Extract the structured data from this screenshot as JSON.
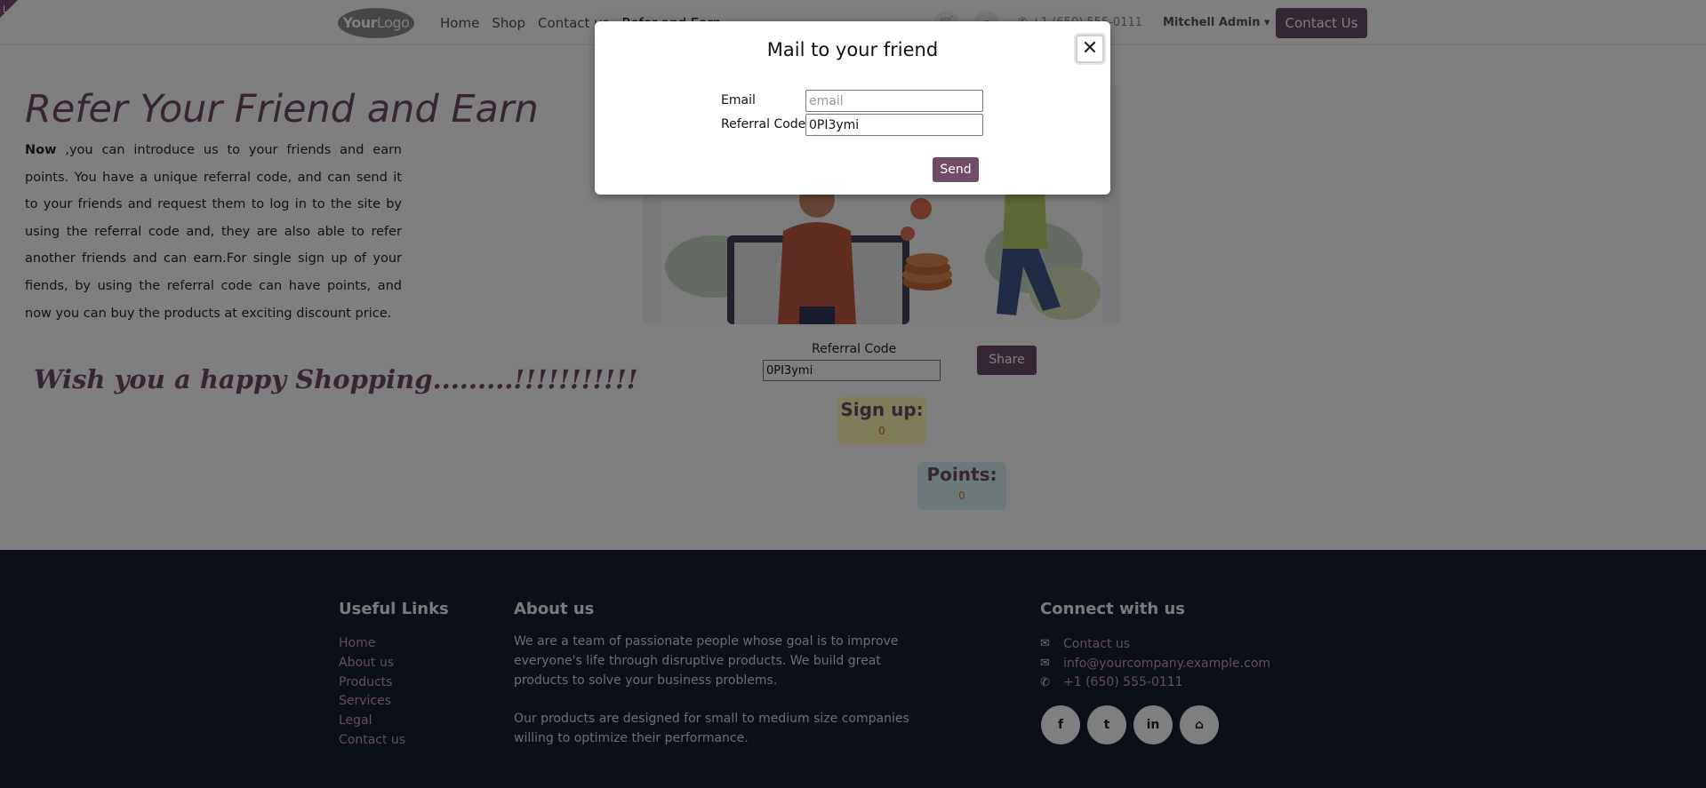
{
  "header": {
    "logo_strong": "Your",
    "logo_light": "Logo",
    "nav": [
      "Home",
      "Shop",
      "Contact us",
      "Refer and Earn"
    ],
    "phone": "+1 (650) 555-0111",
    "user": "Mitchell Admin",
    "contact_button": "Contact Us"
  },
  "main": {
    "title": "Refer Your Friend and Earn",
    "intro_bold": "Now",
    "intro_text": " ,you can introduce us to your friends and earn points. You have a unique referral code, and can send it to your friends and request them to log in to the site by using the referral code and, they are also able to refer another friends and can earn.For single sign up of your fiends, by using the referral code can have points, and now you can buy the products at exciting discount price.",
    "wish": "Wish you a happy Shopping.........!!!!!!!!!!!",
    "referral_label": "Referral Code",
    "referral_code": "0PI3ymi",
    "share_button": "Share",
    "signup": {
      "title": "Sign up:",
      "value": "0"
    },
    "points": {
      "title": "Points:",
      "value": "0"
    }
  },
  "footer": {
    "useful_links_title": "Useful Links",
    "useful_links": [
      "Home",
      "About us",
      "Products",
      "Services",
      "Legal",
      "Contact us"
    ],
    "about_title": "About us",
    "about_p1": "We are a team of passionate people whose goal is to improve everyone's life through disruptive products. We build great products to solve your business problems.",
    "about_p2": "Our products are designed for small to medium size companies willing to optimize their performance.",
    "connect_title": "Connect with us",
    "connect": [
      {
        "icon": "comment-icon",
        "glyph": "✉",
        "text": "Contact us"
      },
      {
        "icon": "envelope-icon",
        "glyph": "✉",
        "text": "info@yourcompany.example.com"
      },
      {
        "icon": "phone-icon",
        "glyph": "✆",
        "text": "+1 (650) 555-0111"
      }
    ],
    "social": [
      "f",
      "t",
      "in",
      "⌂"
    ]
  },
  "modal": {
    "title": "Mail to your friend",
    "close_glyph": "✕",
    "email_label": "Email",
    "email_placeholder": "email",
    "email_value": "",
    "code_label": "Referral Code",
    "code_value": "0PI3ymi",
    "send_button": "Send"
  },
  "colors": {
    "brand": "#714b67",
    "footer_bg": "#141f33",
    "footer_link": "#c89cc0",
    "signup_bg": "#fef9b6",
    "points_bg": "#d8f3f5",
    "value_text": "#e46c0a"
  }
}
